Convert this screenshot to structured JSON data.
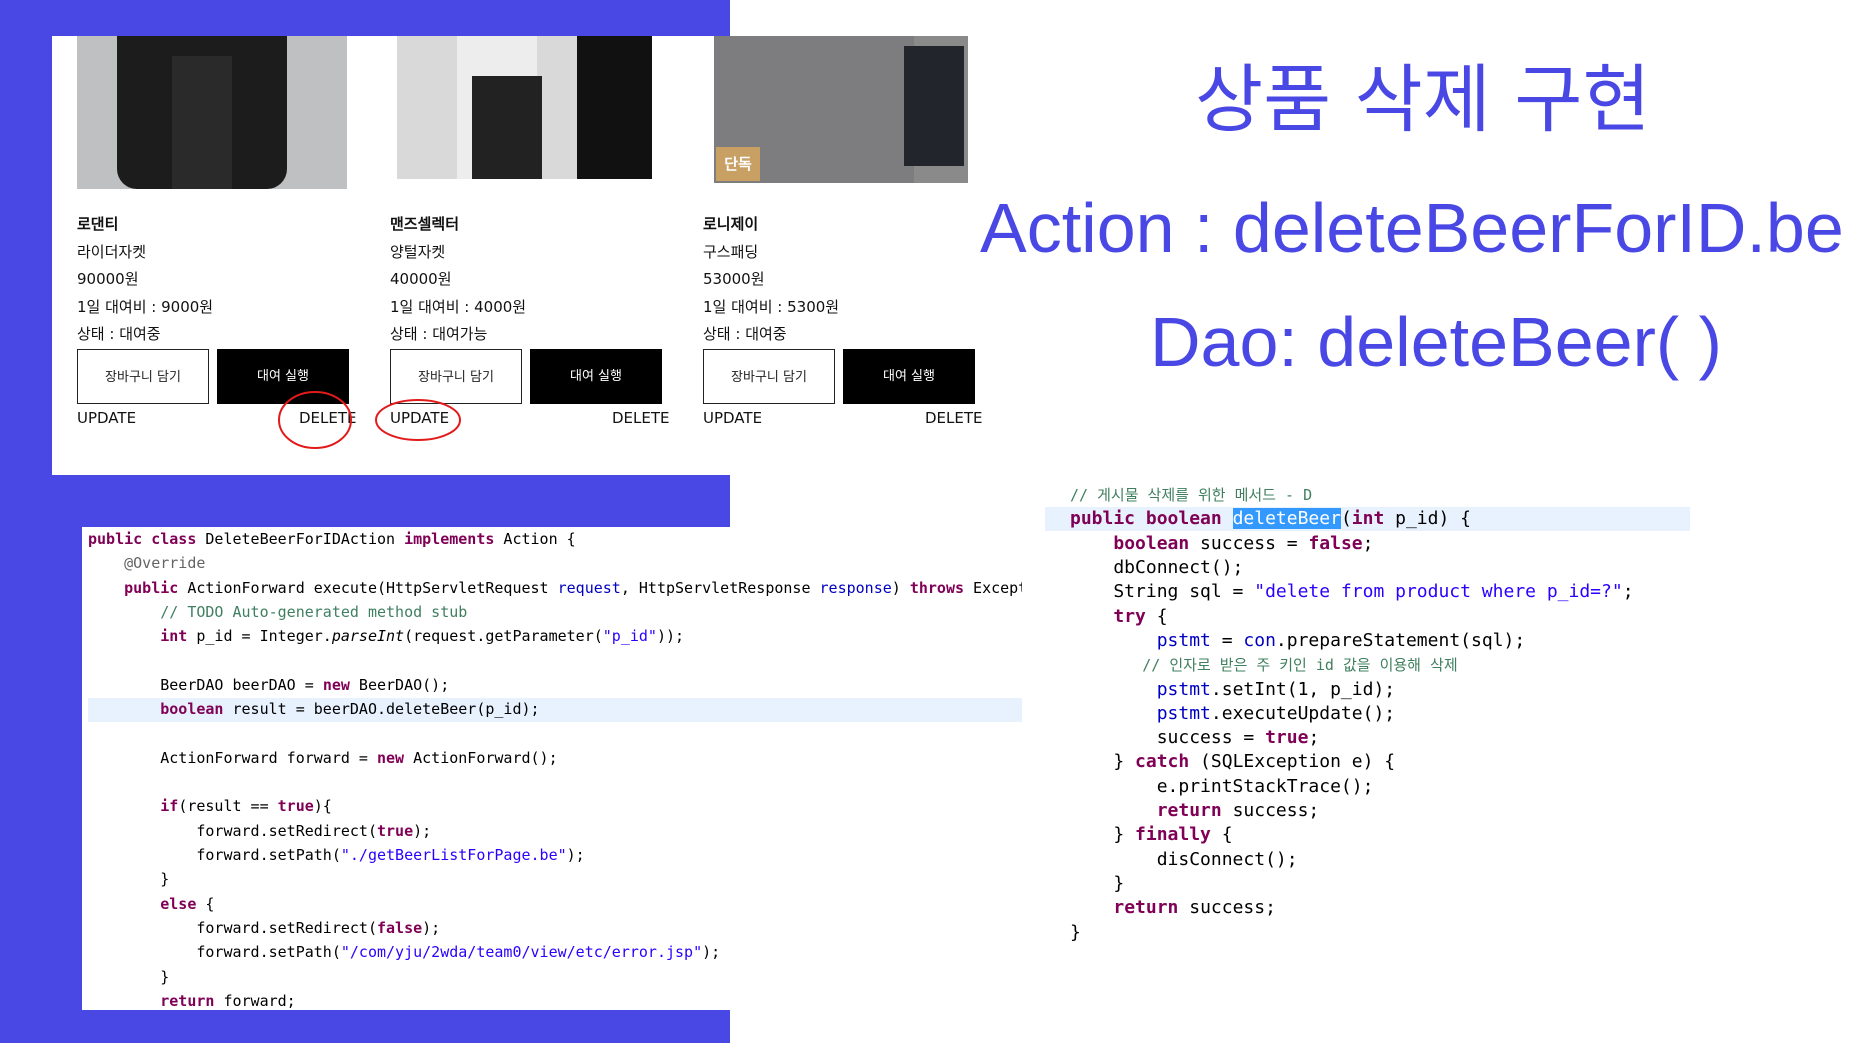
{
  "slide": {
    "title": "상품 삭제 구현",
    "action_line": "Action : deleteBeerForID.be",
    "dao_line": "Dao: deleteBeer( )",
    "accent_color": "#4a48e4"
  },
  "products": [
    {
      "brand": "로댄티",
      "name": "라이더자켓",
      "price": "90000원",
      "daily_fee": "1일 대여비 : 9000원",
      "status": "상태 : 대여중",
      "cart_label": "장바구니 담기",
      "rent_label": "대여 실행",
      "update_label": "UPDATE",
      "delete_label": "DELETE"
    },
    {
      "brand": "맨즈셀렉터",
      "name": "양털자켓",
      "price": "40000원",
      "daily_fee": "1일 대여비 : 4000원",
      "status": "상태 : 대여가능",
      "cart_label": "장바구니 담기",
      "rent_label": "대여 실행",
      "update_label": "UPDATE",
      "delete_label": "DELETE"
    },
    {
      "brand": "로니제이",
      "name": "구스패딩",
      "price": "53000원",
      "daily_fee": "1일 대여비 : 5300원",
      "status": "상태 : 대여중",
      "cart_label": "장바구니 담기",
      "rent_label": "대여 실행",
      "update_label": "UPDATE",
      "delete_label": "DELETE",
      "badge": "단독"
    }
  ],
  "action_code": {
    "lines": [
      "public class DeleteBeerForIDAction implements Action {",
      "    @Override",
      "    public ActionForward execute(HttpServletRequest request, HttpServletResponse response) throws Exception {",
      "        // TODO Auto-generated method stub",
      "        int p_id = Integer.parseInt(request.getParameter(\"p_id\"));",
      "",
      "        BeerDAO beerDAO = new BeerDAO();",
      "        boolean result = beerDAO.deleteBeer(p_id);",
      "",
      "        ActionForward forward = new ActionForward();",
      "",
      "        if(result == true){",
      "            forward.setRedirect(true);",
      "            forward.setPath(\"./getBeerListForPage.be\");",
      "        }",
      "        else {",
      "            forward.setRedirect(false);",
      "            forward.setPath(\"/com/yju/2wda/team0/view/etc/error.jsp\");",
      "        }",
      "        return forward;"
    ]
  },
  "dao_code": {
    "lines": [
      "// 게시물 삭제를 위한 메서드 - D",
      "public boolean deleteBeer(int p_id) {",
      "    boolean success = false;",
      "    dbConnect();",
      "    String sql = \"delete from product where p_id=?\";",
      "    try {",
      "        pstmt = con.prepareStatement(sql);",
      "        // 인자로 받은 주 키인 id 값을 이용해 삭제",
      "        pstmt.setInt(1, p_id);",
      "        pstmt.executeUpdate();",
      "        success = true;",
      "    } catch (SQLException e) {",
      "        e.printStackTrace();",
      "        return success;",
      "    } finally {",
      "        disConnect();",
      "    }",
      "    return success;",
      "}"
    ]
  }
}
